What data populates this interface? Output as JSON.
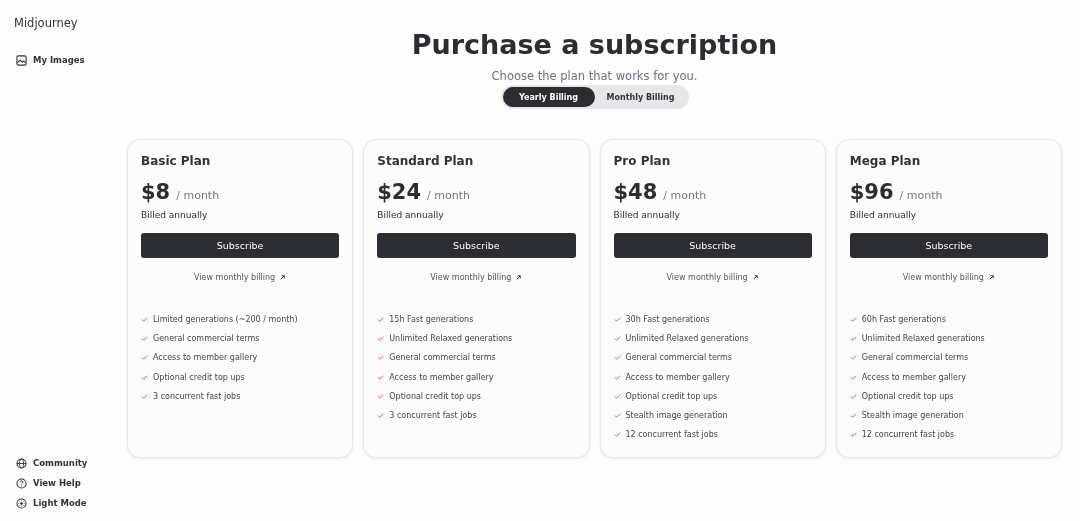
{
  "sidebar": {
    "brand": "Midjourney",
    "top_items": [
      {
        "label": "My Images"
      }
    ],
    "bottom_items": [
      {
        "label": "Community"
      },
      {
        "label": "View Help"
      },
      {
        "label": "Light Mode"
      }
    ]
  },
  "header": {
    "title": "Purchase a subscription",
    "subtitle": "Choose the plan that works for you."
  },
  "billing_tabs": [
    {
      "label": "Yearly Billing",
      "selected": true
    },
    {
      "label": "Monthly Billing",
      "selected": false
    }
  ],
  "plans": [
    {
      "name": "Basic Plan",
      "price": "$8",
      "period": "/ month",
      "billing": "Billed annually",
      "button": "Subscribe",
      "link": "View monthly billing",
      "features": [
        "Limited generations (~200 / month)",
        "General commercial terms",
        "Access to member gallery",
        "Optional credit top ups",
        "3 concurrent fast jobs"
      ]
    },
    {
      "name": "Standard Plan",
      "price": "$24",
      "period": "/ month",
      "billing": "Billed annually",
      "button": "Subscribe",
      "link": "View monthly billing",
      "features": [
        "15h Fast generations",
        "Unlimited Relaxed generations",
        "General commercial terms",
        "Access to member gallery",
        "Optional credit top ups",
        "3 concurrent fast jobs"
      ]
    },
    {
      "name": "Pro Plan",
      "price": "$48",
      "period": "/ month",
      "billing": "Billed annually",
      "button": "Subscribe",
      "link": "View monthly billing",
      "features": [
        "30h Fast generations",
        "Unlimited Relaxed generations",
        "General commercial terms",
        "Access to member gallery",
        "Optional credit top ups",
        "Stealth image generation",
        "12 concurrent fast jobs"
      ]
    },
    {
      "name": "Mega Plan",
      "price": "$96",
      "period": "/ month",
      "billing": "Billed annually",
      "button": "Subscribe",
      "link": "View monthly billing",
      "features": [
        "60h Fast generations",
        "Unlimited Relaxed generations",
        "General commercial terms",
        "Access to member gallery",
        "Optional credit top ups",
        "Stealth image generation",
        "12 concurrent fast jobs"
      ]
    }
  ]
}
